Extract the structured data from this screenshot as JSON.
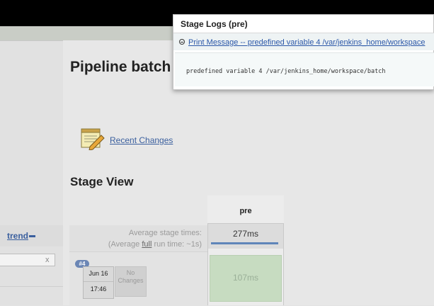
{
  "header": {
    "background": "#000000"
  },
  "page": {
    "title": "Pipeline batch",
    "recent_changes": "Recent Changes",
    "stage_view_title": "Stage View"
  },
  "sidebar": {
    "trend_label": "trend",
    "filter_clear": "x"
  },
  "stage_view": {
    "avg_label": "Average stage times:",
    "avg_full_prefix": "(Average ",
    "avg_full_underlined": "full",
    "avg_full_suffix": " run time: ~1s)",
    "stages": [
      {
        "name": "pre",
        "avg_time": "277ms",
        "avg_bar_fill": 1.0
      }
    ],
    "builds": [
      {
        "number": "#4",
        "date": "Jun 16",
        "time": "17:46",
        "changes_text": "No Changes",
        "cells": [
          {
            "stage": "pre",
            "duration": "107ms",
            "status": "success"
          }
        ]
      }
    ]
  },
  "popup": {
    "title": "Stage Logs (pre)",
    "step_label": "Print Message -- predefined variable 4 /var/jenkins_home/workspace",
    "log_text": "predefined variable 4    /var/jenkins_home/workspace/batch"
  },
  "colors": {
    "link": "#3a5f9e",
    "success_cell": "#c7dcc1",
    "progress_bar": "#5f85b9",
    "build_badge": "#6b86b5"
  }
}
